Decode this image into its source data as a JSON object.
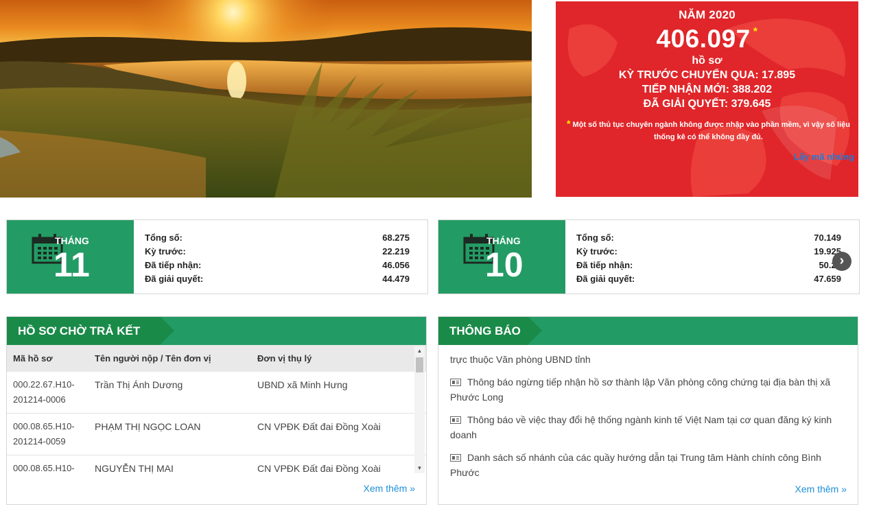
{
  "stats": {
    "year": "NĂM 2020",
    "total": "406.097",
    "star": "*",
    "unit": "hồ sơ",
    "carried_over": "KỲ TRƯỚC CHUYỂN QUA: 17.895",
    "received": "TIẾP NHẬN MỚI: 388.202",
    "resolved": "ĐÃ GIẢI QUYẾT: 379.645",
    "note": "Một số thủ tục chuyên ngành không được nhập vào phần mềm, vì vậy số liệu thống kê có thể không đầy đủ.",
    "embed_link": "Lấy mã nhúng"
  },
  "months": [
    {
      "label": "THÁNG",
      "number": "11",
      "rows": [
        {
          "label": "Tổng số:",
          "value": "68.275"
        },
        {
          "label": "Kỳ trước:",
          "value": "22.219"
        },
        {
          "label": "Đã tiếp nhận:",
          "value": "46.056"
        },
        {
          "label": "Đã giải quyết:",
          "value": "44.479"
        }
      ]
    },
    {
      "label": "THÁNG",
      "number": "10",
      "rows": [
        {
          "label": "Tổng số:",
          "value": "70.149"
        },
        {
          "label": "Kỳ trước:",
          "value": "19.925"
        },
        {
          "label": "Đã tiếp nhận:",
          "value": "50.22"
        },
        {
          "label": "Đã giải quyết:",
          "value": "47.659"
        }
      ]
    }
  ],
  "results_panel": {
    "title": "HỒ SƠ CHỜ TRẢ KẾT QUẢ",
    "columns": [
      "Mã hồ sơ",
      "Tên người nộp / Tên đơn vị",
      "Đơn vị thụ lý"
    ],
    "rows": [
      {
        "code": "000.22.67.H10-201214-0006",
        "name": "Trần Thị Ánh Dương",
        "unit": "UBND xã Minh Hưng"
      },
      {
        "code": "000.08.65.H10-201214-0059",
        "name": "PHẠM THỊ NGỌC LOAN",
        "unit": "CN VPĐK Đất đai Đồng Xoài"
      },
      {
        "code": "000.08.65.H10-",
        "name": "NGUYỄN THỊ MAI",
        "unit": "CN VPĐK Đất đai Đồng Xoài"
      }
    ],
    "more": "Xem thêm »"
  },
  "notice_panel": {
    "title": "THÔNG BÁO",
    "partial_top": "trực thuộc Văn phòng UBND tỉnh",
    "items": [
      "Thông báo ngừng tiếp nhận hồ sơ thành lập Văn phòng công chứng tại địa bàn thị xã Phước Long",
      "Thông báo về việc thay đổi hệ thống ngành kinh tế Việt Nam tại cơ quan đăng ký kinh doanh",
      "Danh sách số nhánh của các quầy hướng dẫn tại Trung tâm Hành chính công Bình Phước"
    ],
    "more": "Xem thêm »"
  },
  "icons": {
    "calendar": "calendar-icon",
    "next": "chevron-right-circle-icon",
    "notice": "newspaper-icon",
    "scroll_up": "scroll-up-icon",
    "scroll_down": "scroll-down-icon"
  },
  "colors": {
    "green": "#239b64",
    "green_dark": "#1a8a49",
    "red": "#e0262a",
    "link": "#1e8fd6"
  }
}
